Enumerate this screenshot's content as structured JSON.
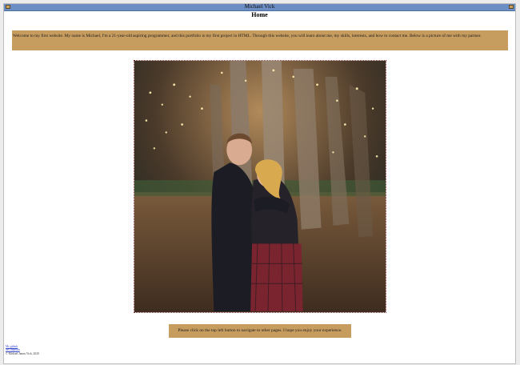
{
  "window": {
    "title": "Michael Vick"
  },
  "page": {
    "heading": "Home",
    "intro": "Welcome to my first website. My name is Michael, I'm a 21-year-old aspiring programmer, and this portfolio is my first project in HTML. Through this website, you will learn about me, my skills, interests, and how to contact me. Below is a picture of me with my partner.",
    "note": "Please click on the top left button to navigate to other pages. I hope you enjoy your experience."
  },
  "footer": {
    "link1": "My github",
    "link2": "My linkedin",
    "copyright": "© Michael James Vick, 2020"
  },
  "colors": {
    "titlebar": "#6b8fc4",
    "panel": "#c79c5f"
  },
  "icons": {
    "menu": "menu-icon",
    "close": "close-icon"
  }
}
